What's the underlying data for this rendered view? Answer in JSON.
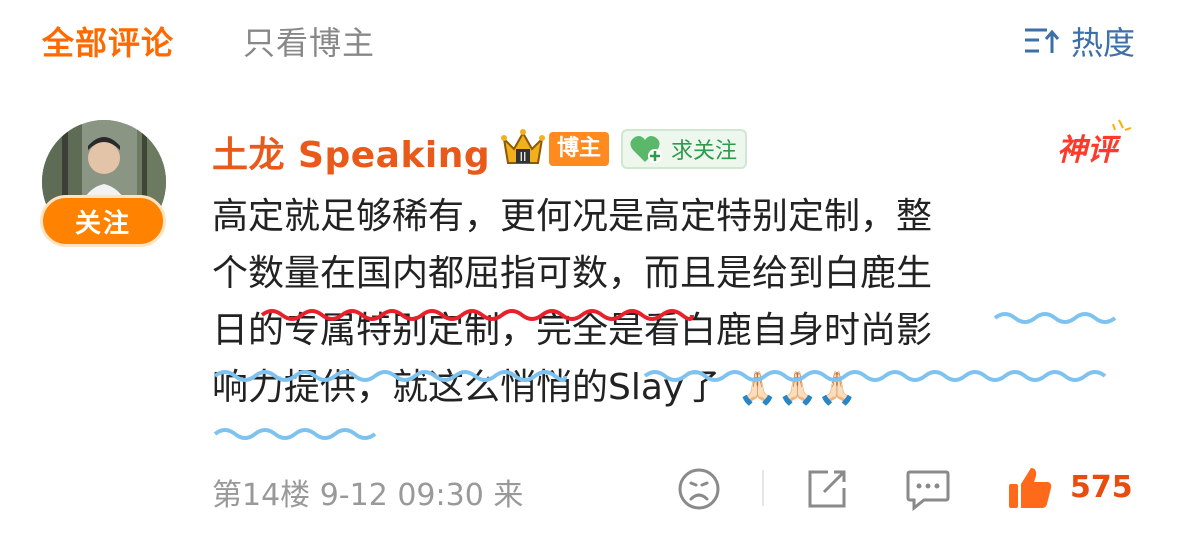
{
  "tabs": {
    "all": "全部评论",
    "author_only": "只看博主",
    "sort_label": "热度"
  },
  "comment": {
    "username": "土龙 Speaking",
    "badge_author": "博主",
    "follow_chip": "求关注",
    "follow_button": "关注",
    "content_lines": [
      "高定就足够稀有，更何况是高定特别定制，整",
      "个数量在国内都屈指可数，而且是给到白鹿生",
      "日的专属特别定制，完全是看白鹿自身时尚影",
      "响力提供，就这么悄悄的Slay了"
    ],
    "emoji": "🙏🏻🙏🏻🙏🏻",
    "meta": "第14楼 9-12 09:30 来",
    "likes": "575"
  },
  "colors": {
    "accent_orange": "#ff6a00",
    "username_orange": "#e8591a",
    "sort_blue": "#3d6fa8",
    "wave_red": "#e8202a",
    "wave_blue": "#7ec3f0"
  },
  "icons": [
    "sort-icon",
    "crown-icon",
    "heart-plus-icon",
    "god-comment-icon",
    "dislike-face-icon",
    "share-icon",
    "reply-icon",
    "like-icon"
  ]
}
